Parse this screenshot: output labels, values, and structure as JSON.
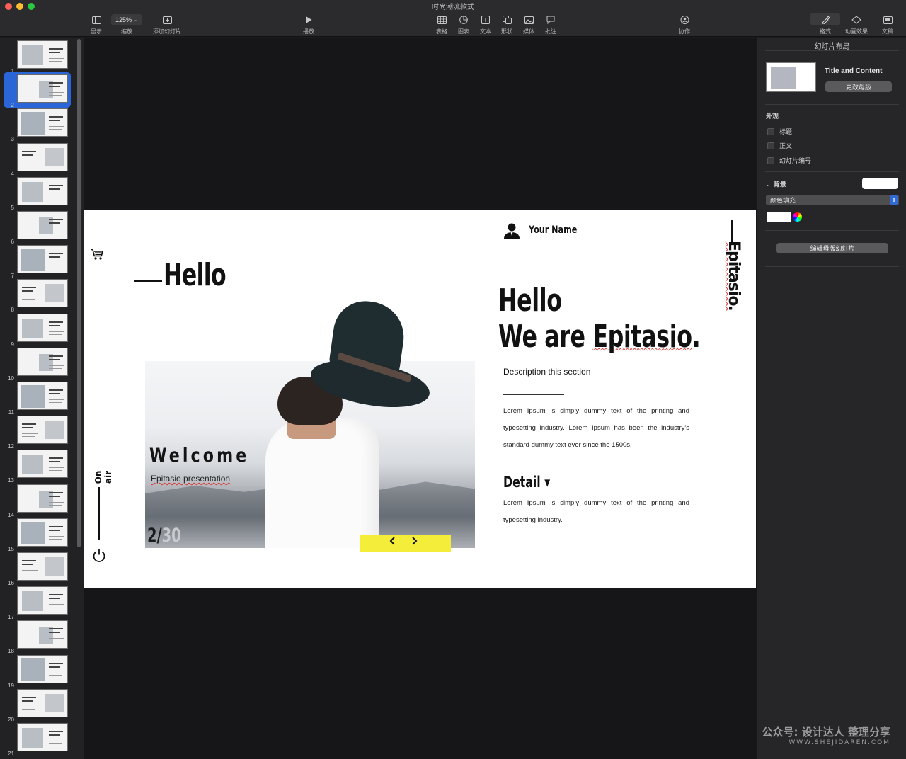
{
  "window": {
    "title": "时尚潮流款式",
    "traffic_colors": [
      "#ff5f57",
      "#febc2e",
      "#28c840"
    ]
  },
  "toolbar": {
    "display": "显示",
    "zoom_value": "125%",
    "zoom": "缩放",
    "add_slide": "添加幻灯片",
    "play": "播放",
    "table": "表格",
    "chart": "图表",
    "text": "文本",
    "shape": "形状",
    "media": "媒体",
    "comment": "批注",
    "collaborate": "协作",
    "format": "格式",
    "animate": "动画效果",
    "document": "文稿"
  },
  "navigator": {
    "selected_index": 2,
    "slides": [
      "1",
      "2",
      "3",
      "4",
      "5",
      "6",
      "7",
      "8",
      "9",
      "10",
      "11",
      "12",
      "13",
      "14",
      "15",
      "16",
      "17",
      "18",
      "19",
      "20",
      "21"
    ],
    "thumbnail_texts": {
      "s1": "Epitasio",
      "s2": "Hello We are Epitasio",
      "s4": "Designed to Make someone's life easier",
      "s9": "The Best Digital Products",
      "s10": "Make our work fun",
      "s11": "Choose your style",
      "s14": "Your Last presentation",
      "s16": "Our Plans Strategy",
      "s17": "Building Leadership Training",
      "s18": "Multi Project Presentation",
      "s19": "Choose your style Help & Easy",
      "s21": "Your Last presentation"
    }
  },
  "slide": {
    "hello_left": "Hello",
    "welcome": "Welcome",
    "welcome_sub": "Epitasio presentation",
    "page_current": "2/",
    "page_total": "30",
    "on_air": "On air",
    "your_name": "Your Name",
    "hello_right_1": "Hello",
    "hello_right_2_prefix": "We are ",
    "hello_right_2_brand": "Epitasio",
    "hello_right_2_suffix": ".",
    "desc_title": "Description this section",
    "body_1": "Lorem Ipsum is simply dummy text of the printing and typesetting industry. Lorem Ipsum has been the industry's standard dummy text ever since the 1500s,",
    "detail": "Detail ▾",
    "body_2": "Lorem Ipsum is simply dummy text of the printing and typesetting industry.",
    "vertical_brand": "Epitasio.",
    "accent_yellow": "#f4ee3a"
  },
  "inspector": {
    "title": "幻灯片布局",
    "layout_name": "Title and Content",
    "change_master": "更改母版",
    "appearance": "外观",
    "cb_title": "标题",
    "cb_body": "正文",
    "cb_slide_number": "幻灯片编号",
    "background": "背景",
    "fill_type": "颜色填充",
    "edit_master": "编辑母版幻灯片"
  },
  "watermark": {
    "line1": "公众号: 设计达人 整理分享",
    "line2": "WWW.SHEJIDAREN.COM"
  }
}
